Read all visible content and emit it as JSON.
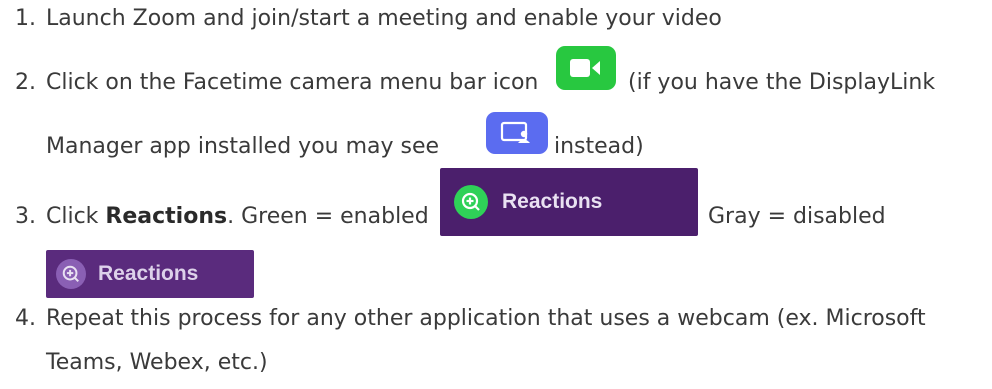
{
  "steps": [
    {
      "number": "1.",
      "text": "Launch Zoom and join/start a meeting and enable your video"
    },
    {
      "number": "2.",
      "text_before": "Click on the Facetime camera menu bar icon",
      "text_after": "(if you have the DisplayLink",
      "line2_before": "Manager app installed you may see",
      "line2_after": "instead)"
    },
    {
      "number": "3.",
      "text_before": "Click ",
      "bold": "Reactions",
      "text_mid": ". Green = enabled",
      "text_after": "Gray = disabled"
    },
    {
      "number": "4.",
      "line1": "Repeat this process for any other application that uses a webcam (ex. Microsoft",
      "line2": "Teams, Webex, etc.)"
    }
  ],
  "reactions_label": "Reactions",
  "colors": {
    "camera_icon": "#28c840",
    "displaylink_icon": "#5b6cf0",
    "reactions_enabled_bg": "#4b1f6c",
    "reactions_disabled_bg": "#5a2b7d"
  },
  "icons": {
    "camera": "video-camera-icon",
    "displaylink": "display-person-icon",
    "reactions": "zoom-plus-icon"
  }
}
